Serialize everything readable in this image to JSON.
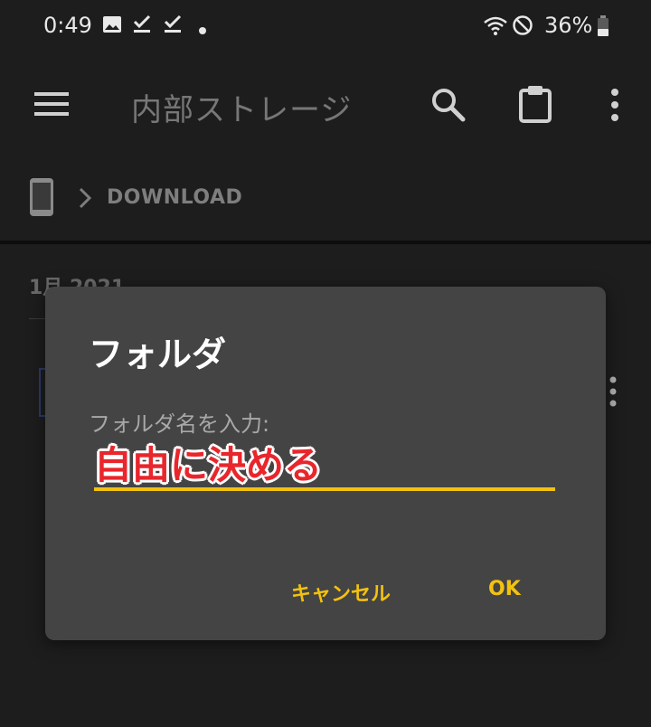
{
  "status_bar": {
    "time": "0:49",
    "battery": "36%",
    "icons": [
      "image-icon",
      "check-icon",
      "check-icon",
      "dot-icon",
      "wifi-icon",
      "dnd-icon",
      "battery-icon"
    ]
  },
  "app_bar": {
    "title": "内部ストレージ",
    "actions": [
      "search-icon",
      "clipboard-icon",
      "more-vert-icon"
    ]
  },
  "breadcrumb": {
    "root_icon": "phone-icon",
    "path": "DOWNLOAD"
  },
  "list": {
    "section_header": "1月 2021"
  },
  "dialog": {
    "title": "フォルダ",
    "prompt": "フォルダ名を入力:",
    "input_value": "自由に決める",
    "cancel_label": "キャンセル",
    "ok_label": "OK"
  },
  "colors": {
    "background": "#1d1d1d",
    "dialog": "#444444",
    "accent": "#f3c20f",
    "annotation": "#e8262c"
  }
}
